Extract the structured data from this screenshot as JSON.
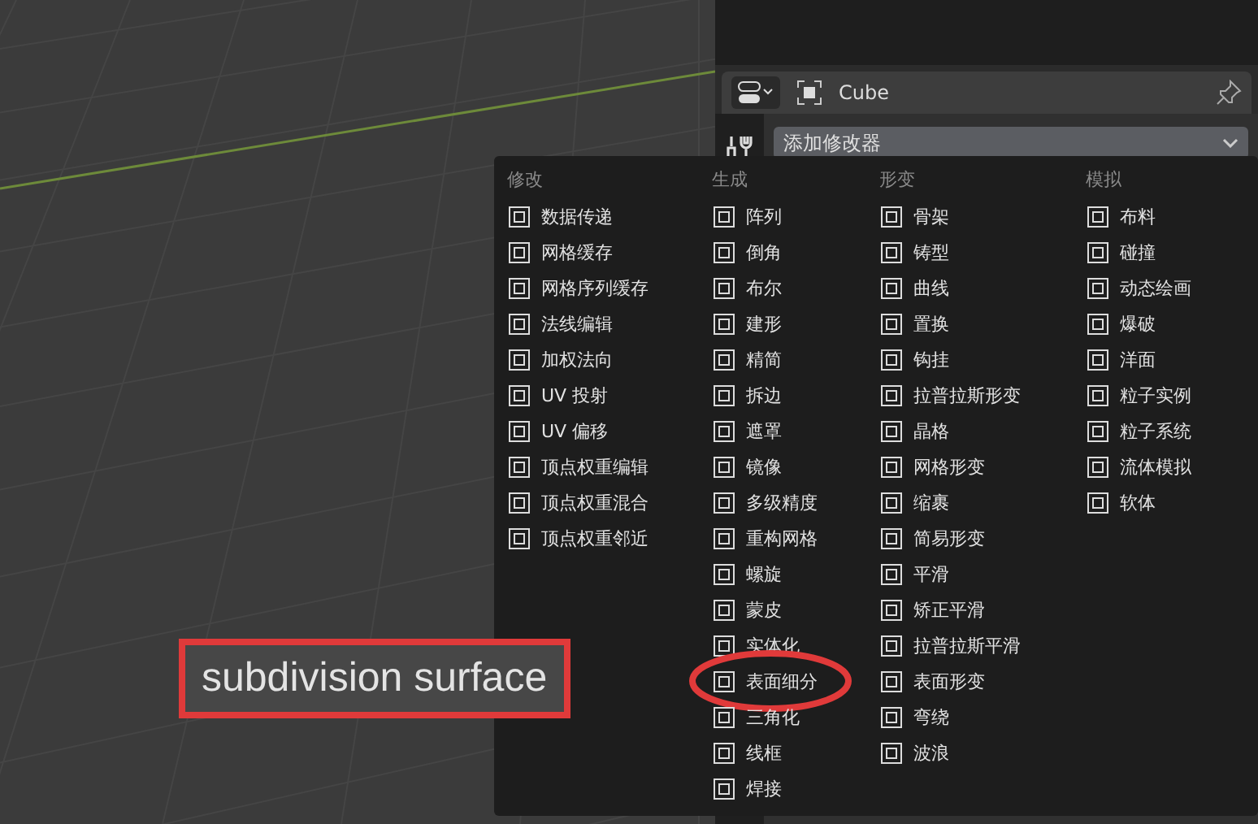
{
  "properties": {
    "object_name": "Cube",
    "dropdown": "添加修改器"
  },
  "menu": {
    "columns": [
      {
        "heading": "修改",
        "items": [
          {
            "label": "数据传递",
            "circled": false
          },
          {
            "label": "网格缓存",
            "circled": false
          },
          {
            "label": "网格序列缓存",
            "circled": false
          },
          {
            "label": "法线编辑",
            "circled": false
          },
          {
            "label": "加权法向",
            "circled": false
          },
          {
            "label": "UV 投射",
            "circled": false
          },
          {
            "label": "UV 偏移",
            "circled": false
          },
          {
            "label": "顶点权重编辑",
            "circled": false
          },
          {
            "label": "顶点权重混合",
            "circled": false
          },
          {
            "label": "顶点权重邻近",
            "circled": false
          }
        ]
      },
      {
        "heading": "生成",
        "items": [
          {
            "label": "阵列",
            "circled": false
          },
          {
            "label": "倒角",
            "circled": false
          },
          {
            "label": "布尔",
            "circled": false
          },
          {
            "label": "建形",
            "circled": false
          },
          {
            "label": "精简",
            "circled": false
          },
          {
            "label": "拆边",
            "circled": false
          },
          {
            "label": "遮罩",
            "circled": false
          },
          {
            "label": "镜像",
            "circled": false
          },
          {
            "label": "多级精度",
            "circled": false
          },
          {
            "label": "重构网格",
            "circled": false
          },
          {
            "label": "螺旋",
            "circled": false
          },
          {
            "label": "蒙皮",
            "circled": false
          },
          {
            "label": "实体化",
            "circled": false
          },
          {
            "label": "表面细分",
            "circled": true
          },
          {
            "label": "三角化",
            "circled": false
          },
          {
            "label": "线框",
            "circled": false
          },
          {
            "label": "焊接",
            "circled": false
          }
        ]
      },
      {
        "heading": "形变",
        "items": [
          {
            "label": "骨架",
            "circled": false
          },
          {
            "label": "铸型",
            "circled": false
          },
          {
            "label": "曲线",
            "circled": false
          },
          {
            "label": "置换",
            "circled": false
          },
          {
            "label": "钩挂",
            "circled": false
          },
          {
            "label": "拉普拉斯形变",
            "circled": false
          },
          {
            "label": "晶格",
            "circled": false
          },
          {
            "label": "网格形变",
            "circled": false
          },
          {
            "label": "缩裹",
            "circled": false
          },
          {
            "label": "简易形变",
            "circled": false
          },
          {
            "label": "平滑",
            "circled": false
          },
          {
            "label": "矫正平滑",
            "circled": false
          },
          {
            "label": "拉普拉斯平滑",
            "circled": false
          },
          {
            "label": "表面形变",
            "circled": false
          },
          {
            "label": "弯绕",
            "circled": false
          },
          {
            "label": "波浪",
            "circled": false
          }
        ]
      },
      {
        "heading": "模拟",
        "items": [
          {
            "label": "布料",
            "circled": false
          },
          {
            "label": "碰撞",
            "circled": false
          },
          {
            "label": "动态绘画",
            "circled": false
          },
          {
            "label": "爆破",
            "circled": false
          },
          {
            "label": "洋面",
            "circled": false
          },
          {
            "label": "粒子实例",
            "circled": false
          },
          {
            "label": "粒子系统",
            "circled": false
          },
          {
            "label": "流体模拟",
            "circled": false
          },
          {
            "label": "软体",
            "circled": false
          }
        ]
      }
    ]
  },
  "annotation": {
    "label": "subdivision surface"
  }
}
